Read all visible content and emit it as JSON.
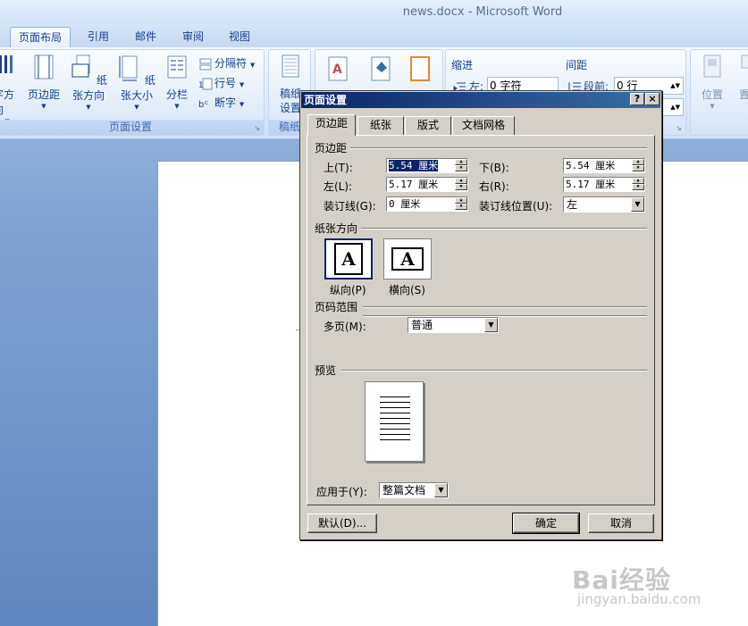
{
  "window": {
    "title": "news.docx - Microsoft Word"
  },
  "ribbon_tabs": [
    "页面布局",
    "引用",
    "邮件",
    "审阅",
    "视图"
  ],
  "ribbon": {
    "page_setup": {
      "label": "页面设置",
      "buttons": [
        "文字方向",
        "页边距",
        "纸张方向",
        "纸张大小",
        "分栏"
      ],
      "small": [
        "分隔符",
        "行号",
        "断字"
      ]
    },
    "draft": {
      "label": "稿纸",
      "button": "稿纸\n设置"
    },
    "paragraph": {
      "indent_label": "缩进",
      "indent_left_label": "左:",
      "indent_left_value": "0 字符",
      "spacing_label": "间距",
      "spacing_before_label": "段前:",
      "spacing_before_value": "0 行"
    },
    "arrange": {
      "position": "位置",
      "wrap": "置于"
    }
  },
  "dialog": {
    "title": "页面设置",
    "help_button": "?",
    "close_button": "×",
    "tabs": [
      "页边距",
      "纸张",
      "版式",
      "文档网格"
    ],
    "margins": {
      "section": "页边距",
      "top_label": "上(T):",
      "top_value": "5.54 厘米",
      "bottom_label": "下(B):",
      "bottom_value": "5.54 厘米",
      "left_label": "左(L):",
      "left_value": "5.17 厘米",
      "right_label": "右(R):",
      "right_value": "5.17 厘米",
      "gutter_label": "装订线(G):",
      "gutter_value": "0 厘米",
      "gutter_pos_label": "装订线位置(U):",
      "gutter_pos_value": "左"
    },
    "orientation": {
      "section": "纸张方向",
      "portrait": "纵向(P)",
      "landscape": "横向(S)",
      "icon_letter": "A",
      "selected": "portrait"
    },
    "pages": {
      "section": "页码范围",
      "multiple_label": "多页(M):",
      "multiple_value": "普通"
    },
    "preview": {
      "section": "预览"
    },
    "apply_label": "应用于(Y):",
    "apply_value": "整篇文档",
    "default_button": "默认(D)...",
    "ok_button": "确定",
    "cancel_button": "取消"
  },
  "watermark": {
    "brand": "Bai经验",
    "url": "jingyan.baidu.com"
  }
}
